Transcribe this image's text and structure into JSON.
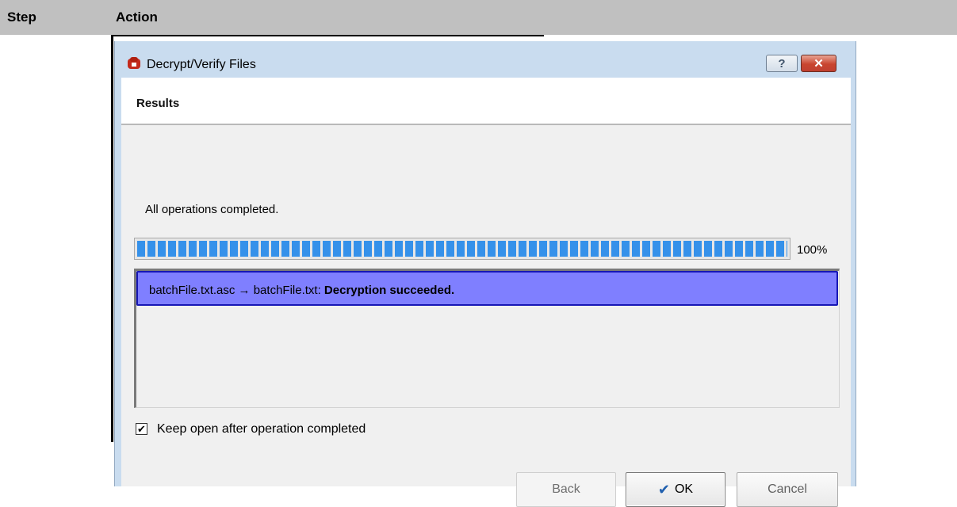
{
  "doc": {
    "step_header": "Step",
    "action_header": "Action"
  },
  "window": {
    "title": "Decrypt/Verify Files",
    "help_label": "?",
    "close_label": "✕",
    "icon": "app-lock-icon"
  },
  "page": {
    "title": "Results"
  },
  "status": {
    "text": "All operations completed."
  },
  "progress": {
    "value": 1.0,
    "label": "100%",
    "color": "#3591ea"
  },
  "results": [
    {
      "text": "batchFile.txt.asc → batchFile.txt: ",
      "status": "Decryption succeeded."
    }
  ],
  "keep_open": {
    "label": "Keep open after operation completed",
    "checked": true,
    "mark": "✔"
  },
  "buttons": {
    "back": "Back",
    "ok": "OK",
    "ok_icon": "✔",
    "cancel": "Cancel"
  },
  "colors": {
    "selection": "#7f7fff",
    "selection_border": "#1717b5",
    "frame": "#c9dcef",
    "close": "#c9452f"
  }
}
